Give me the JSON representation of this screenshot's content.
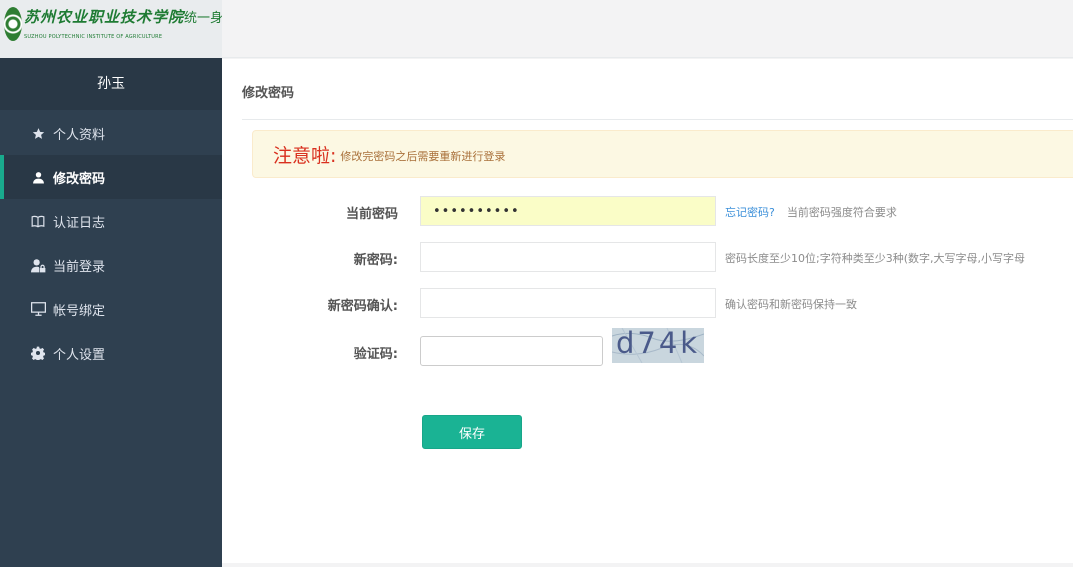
{
  "logo": {
    "school_name": "苏州农业职业技术学院",
    "system_name": "统一身份认证",
    "english_name": "SUZHOU POLYTECHNIC INSTITUTE OF AGRICULTURE"
  },
  "user": {
    "name": "孙玉"
  },
  "sidebar": {
    "items": [
      {
        "label": "个人资料",
        "icon": "star-icon",
        "active": false
      },
      {
        "label": "修改密码",
        "icon": "user-icon",
        "active": true
      },
      {
        "label": "认证日志",
        "icon": "book-icon",
        "active": false
      },
      {
        "label": "当前登录",
        "icon": "user-lock-icon",
        "active": false
      },
      {
        "label": "帐号绑定",
        "icon": "monitor-icon",
        "active": false
      },
      {
        "label": "个人设置",
        "icon": "gear-icon",
        "active": false
      }
    ]
  },
  "page": {
    "title": "修改密码",
    "notice_strong": "注意啦:",
    "notice_text": "修改完密码之后需要重新进行登录"
  },
  "form": {
    "current_password": {
      "label": "当前密码",
      "value": "••••••••••",
      "forgot_link": "忘记密码?",
      "help": "当前密码强度符合要求"
    },
    "new_password": {
      "label": "新密码:",
      "value": "",
      "help": "密码长度至少10位;字符种类至少3种(数字,大写字母,小写字母"
    },
    "confirm_password": {
      "label": "新密码确认:",
      "value": "",
      "help": "确认密码和新密码保持一致"
    },
    "captcha": {
      "label": "验证码:",
      "value": "",
      "image_text": "d74k"
    },
    "save_label": "保存"
  },
  "colors": {
    "sidebar_bg": "#2f4050",
    "sidebar_active_bg": "#293846",
    "accent": "#1ab394",
    "notice_red": "#d9301f"
  }
}
